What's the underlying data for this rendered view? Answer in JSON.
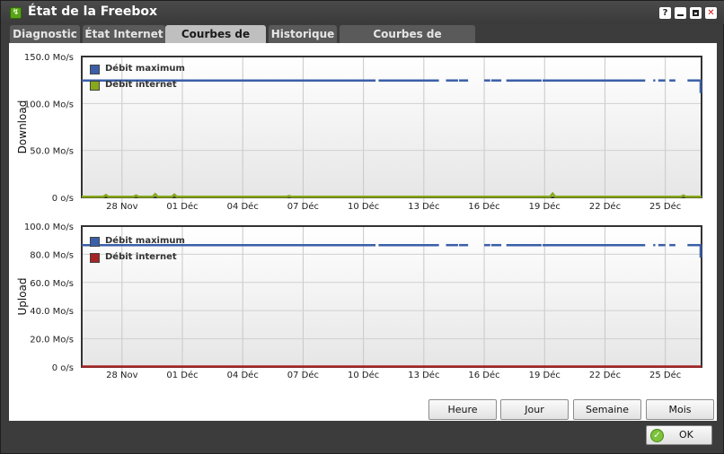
{
  "window": {
    "title": "État de la Freebox"
  },
  "title_buttons": {
    "help": "?",
    "close": "✕"
  },
  "tabs": [
    {
      "label": "Diagnostic"
    },
    {
      "label": "État Internet"
    },
    {
      "label": "Courbes de Débit",
      "active": true
    },
    {
      "label": "Historique"
    },
    {
      "label": "Courbes de température"
    }
  ],
  "range_buttons": [
    "Heure",
    "Jour",
    "Semaine",
    "Mois"
  ],
  "ok_button": {
    "label": "OK"
  },
  "colors": {
    "max": "#3a5fa8",
    "down": "#88a81c",
    "up": "#a82424"
  },
  "chart_data": [
    {
      "type": "line",
      "ylabel": "Download",
      "ylim": [
        0,
        150
      ],
      "yticks": [
        "150.0 Mo/s",
        "100.0 Mo/s",
        "50.0 Mo/s",
        "0 o/s"
      ],
      "ytick_values": [
        150,
        100,
        50,
        0
      ],
      "xticks": [
        "28 Nov",
        "01 Déc",
        "04 Déc",
        "07 Déc",
        "10 Déc",
        "13 Déc",
        "16 Déc",
        "19 Déc",
        "22 Déc",
        "25 Déc"
      ],
      "xtick_days": [
        2,
        5,
        8,
        11,
        14,
        17,
        20,
        23,
        26,
        29
      ],
      "x_range_days": [
        0,
        30.8
      ],
      "series": [
        {
          "name": "Débit maximum",
          "color": "#3a5fa8",
          "level": 124.5,
          "gaps": [
            [
              14.6,
              14.75
            ],
            [
              17.75,
              18.1
            ],
            [
              18.7,
              18.75
            ],
            [
              19.2,
              20.0
            ],
            [
              20.3,
              20.35
            ],
            [
              20.85,
              21.1
            ],
            [
              22.85,
              22.9
            ],
            [
              28.0,
              28.4
            ],
            [
              28.5,
              28.65
            ],
            [
              29.0,
              29.2
            ],
            [
              29.5,
              30.1
            ]
          ]
        },
        {
          "name": "Débit internet",
          "color": "#88a81c",
          "level": 0.8,
          "spikes": [
            [
              1.2,
              2.5
            ],
            [
              2.7,
              2.0
            ],
            [
              3.65,
              3.5
            ],
            [
              4.6,
              3.0
            ],
            [
              10.3,
              1.5
            ],
            [
              23.4,
              4.0
            ],
            [
              29.9,
              2.0
            ]
          ]
        }
      ],
      "grid": true,
      "legend_position": "top-left"
    },
    {
      "type": "line",
      "ylabel": "Upload",
      "ylim": [
        0,
        100
      ],
      "yticks": [
        "100.0 Mo/s",
        "80.0 Mo/s",
        "60.0 Mo/s",
        "40.0 Mo/s",
        "20.0 Mo/s",
        "0 o/s"
      ],
      "ytick_values": [
        100,
        80,
        60,
        40,
        20,
        0
      ],
      "xticks": [
        "28 Nov",
        "01 Déc",
        "04 Déc",
        "07 Déc",
        "10 Déc",
        "13 Déc",
        "16 Déc",
        "19 Déc",
        "22 Déc",
        "25 Déc"
      ],
      "xtick_days": [
        2,
        5,
        8,
        11,
        14,
        17,
        20,
        23,
        26,
        29
      ],
      "x_range_days": [
        0,
        30.8
      ],
      "series": [
        {
          "name": "Débit maximum",
          "color": "#3a5fa8",
          "level": 86.5,
          "gaps": [
            [
              14.6,
              14.75
            ],
            [
              17.75,
              18.1
            ],
            [
              18.7,
              18.75
            ],
            [
              19.2,
              20.0
            ],
            [
              20.3,
              20.35
            ],
            [
              20.85,
              21.1
            ],
            [
              22.85,
              22.9
            ],
            [
              28.0,
              28.4
            ],
            [
              28.5,
              28.65
            ],
            [
              29.0,
              29.2
            ],
            [
              29.5,
              30.1
            ]
          ]
        },
        {
          "name": "Débit internet",
          "color": "#a82424",
          "level": 0.3,
          "spikes": []
        }
      ],
      "grid": true,
      "legend_position": "top-left"
    }
  ]
}
